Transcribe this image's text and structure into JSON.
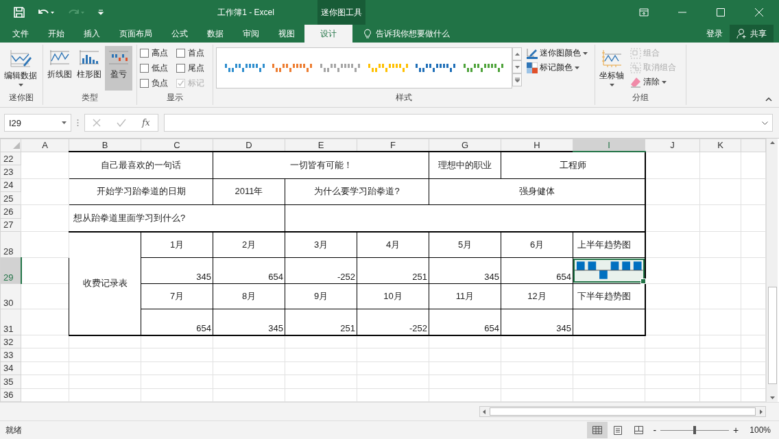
{
  "title_bar": {
    "title": "工作簿1 - Excel",
    "context_label": "迷你图工具"
  },
  "tabs": [
    {
      "label": "文件",
      "selected": false
    },
    {
      "label": "开始",
      "selected": false
    },
    {
      "label": "插入",
      "selected": false
    },
    {
      "label": "页面布局",
      "selected": false
    },
    {
      "label": "公式",
      "selected": false
    },
    {
      "label": "数据",
      "selected": false
    },
    {
      "label": "审阅",
      "selected": false
    },
    {
      "label": "视图",
      "selected": false
    },
    {
      "label": "设计",
      "selected": true
    }
  ],
  "tell_me": "告诉我你想要做什么",
  "sign_in": "登录",
  "share": "共享",
  "ribbon": {
    "sparkline_group": {
      "button": "编辑数据",
      "label": "迷你图"
    },
    "type_group": {
      "label": "类型",
      "types": [
        {
          "label": "折线图",
          "kind": "line",
          "selected": false
        },
        {
          "label": "柱形图",
          "kind": "column",
          "selected": false
        },
        {
          "label": "盈亏",
          "kind": "winloss",
          "selected": true
        }
      ]
    },
    "show_group": {
      "label": "显示",
      "options": [
        {
          "label": "高点",
          "checked": false,
          "disabled": false
        },
        {
          "label": "首点",
          "checked": false,
          "disabled": false
        },
        {
          "label": "低点",
          "checked": false,
          "disabled": false
        },
        {
          "label": "尾点",
          "checked": false,
          "disabled": false
        },
        {
          "label": "负点",
          "checked": false,
          "disabled": false
        },
        {
          "label": "标记",
          "checked": true,
          "disabled": true
        }
      ]
    },
    "style_group": {
      "label": "样式",
      "styles": [
        {
          "color": "#2e8ece"
        },
        {
          "color": "#ed7d31"
        },
        {
          "color": "#a5a5a5"
        },
        {
          "color": "#ffc000"
        },
        {
          "color": "#1f6fb8"
        },
        {
          "color": "#4ea33a"
        }
      ],
      "sparkline_color": "迷你图颜色",
      "marker_color": "标记颜色"
    },
    "group_group": {
      "label": "分组",
      "axis": "坐标轴",
      "group": "组合",
      "ungroup": "取消组合",
      "clear": "清除"
    }
  },
  "formula_bar": {
    "name_box": "I29",
    "fx": "fx"
  },
  "sheet": {
    "columns": [
      {
        "label": "A",
        "selected": false
      },
      {
        "label": "B",
        "selected": false
      },
      {
        "label": "C",
        "selected": false
      },
      {
        "label": "D",
        "selected": false
      },
      {
        "label": "E",
        "selected": false
      },
      {
        "label": "F",
        "selected": false
      },
      {
        "label": "G",
        "selected": false
      },
      {
        "label": "H",
        "selected": false
      },
      {
        "label": "I",
        "selected": true
      },
      {
        "label": "J",
        "selected": false
      },
      {
        "label": "K",
        "selected": false
      }
    ],
    "rows": [
      {
        "label": "22",
        "selected": false
      },
      {
        "label": "23",
        "selected": false
      },
      {
        "label": "24",
        "selected": false
      },
      {
        "label": "25",
        "selected": false
      },
      {
        "label": "26",
        "selected": false
      },
      {
        "label": "27",
        "selected": false
      },
      {
        "label": "28",
        "selected": false
      },
      {
        "label": "29",
        "selected": true
      },
      {
        "label": "30",
        "selected": false
      },
      {
        "label": "31",
        "selected": false
      },
      {
        "label": "32",
        "selected": false
      },
      {
        "label": "33",
        "selected": false
      },
      {
        "label": "34",
        "selected": false
      },
      {
        "label": "35",
        "selected": false
      },
      {
        "label": "36",
        "selected": false
      }
    ]
  },
  "form": {
    "quote": {
      "label": "自己最喜欢的一句话",
      "value": "一切皆有可能！"
    },
    "job": {
      "label": "理想中的职业",
      "value": "工程师"
    },
    "start": {
      "label": "开始学习跆拳道的日期",
      "value": "2011年"
    },
    "reason": {
      "label": "为什么要学习跆拳道?",
      "value": "强身健体"
    },
    "goal": {
      "label": "想从跆拳道里面学习到什么?"
    },
    "fees": {
      "label": "收费记录表",
      "halves": [
        {
          "months": [
            "1月",
            "2月",
            "3月",
            "4月",
            "5月",
            "6月"
          ],
          "amounts": [
            "345",
            "654",
            "-252",
            "251",
            "345",
            "654"
          ],
          "trend_label": "上半年趋势图",
          "sparkline": true
        },
        {
          "months": [
            "7月",
            "8月",
            "9月",
            "10月",
            "11月",
            "12月"
          ],
          "amounts": [
            "654",
            "345",
            "251",
            "-252",
            "654",
            "345"
          ],
          "trend_label": "下半年趋势图",
          "sparkline": false
        }
      ]
    }
  },
  "status_bar": {
    "status": "就绪",
    "views": [
      {
        "kind": "normal",
        "selected": true
      },
      {
        "kind": "layout",
        "selected": false
      },
      {
        "kind": "pagebreak",
        "selected": false
      }
    ],
    "zoom_out": "-",
    "zoom_in": "+",
    "zoom": {
      "level": 0.5
    },
    "zoom_text": "100%"
  }
}
